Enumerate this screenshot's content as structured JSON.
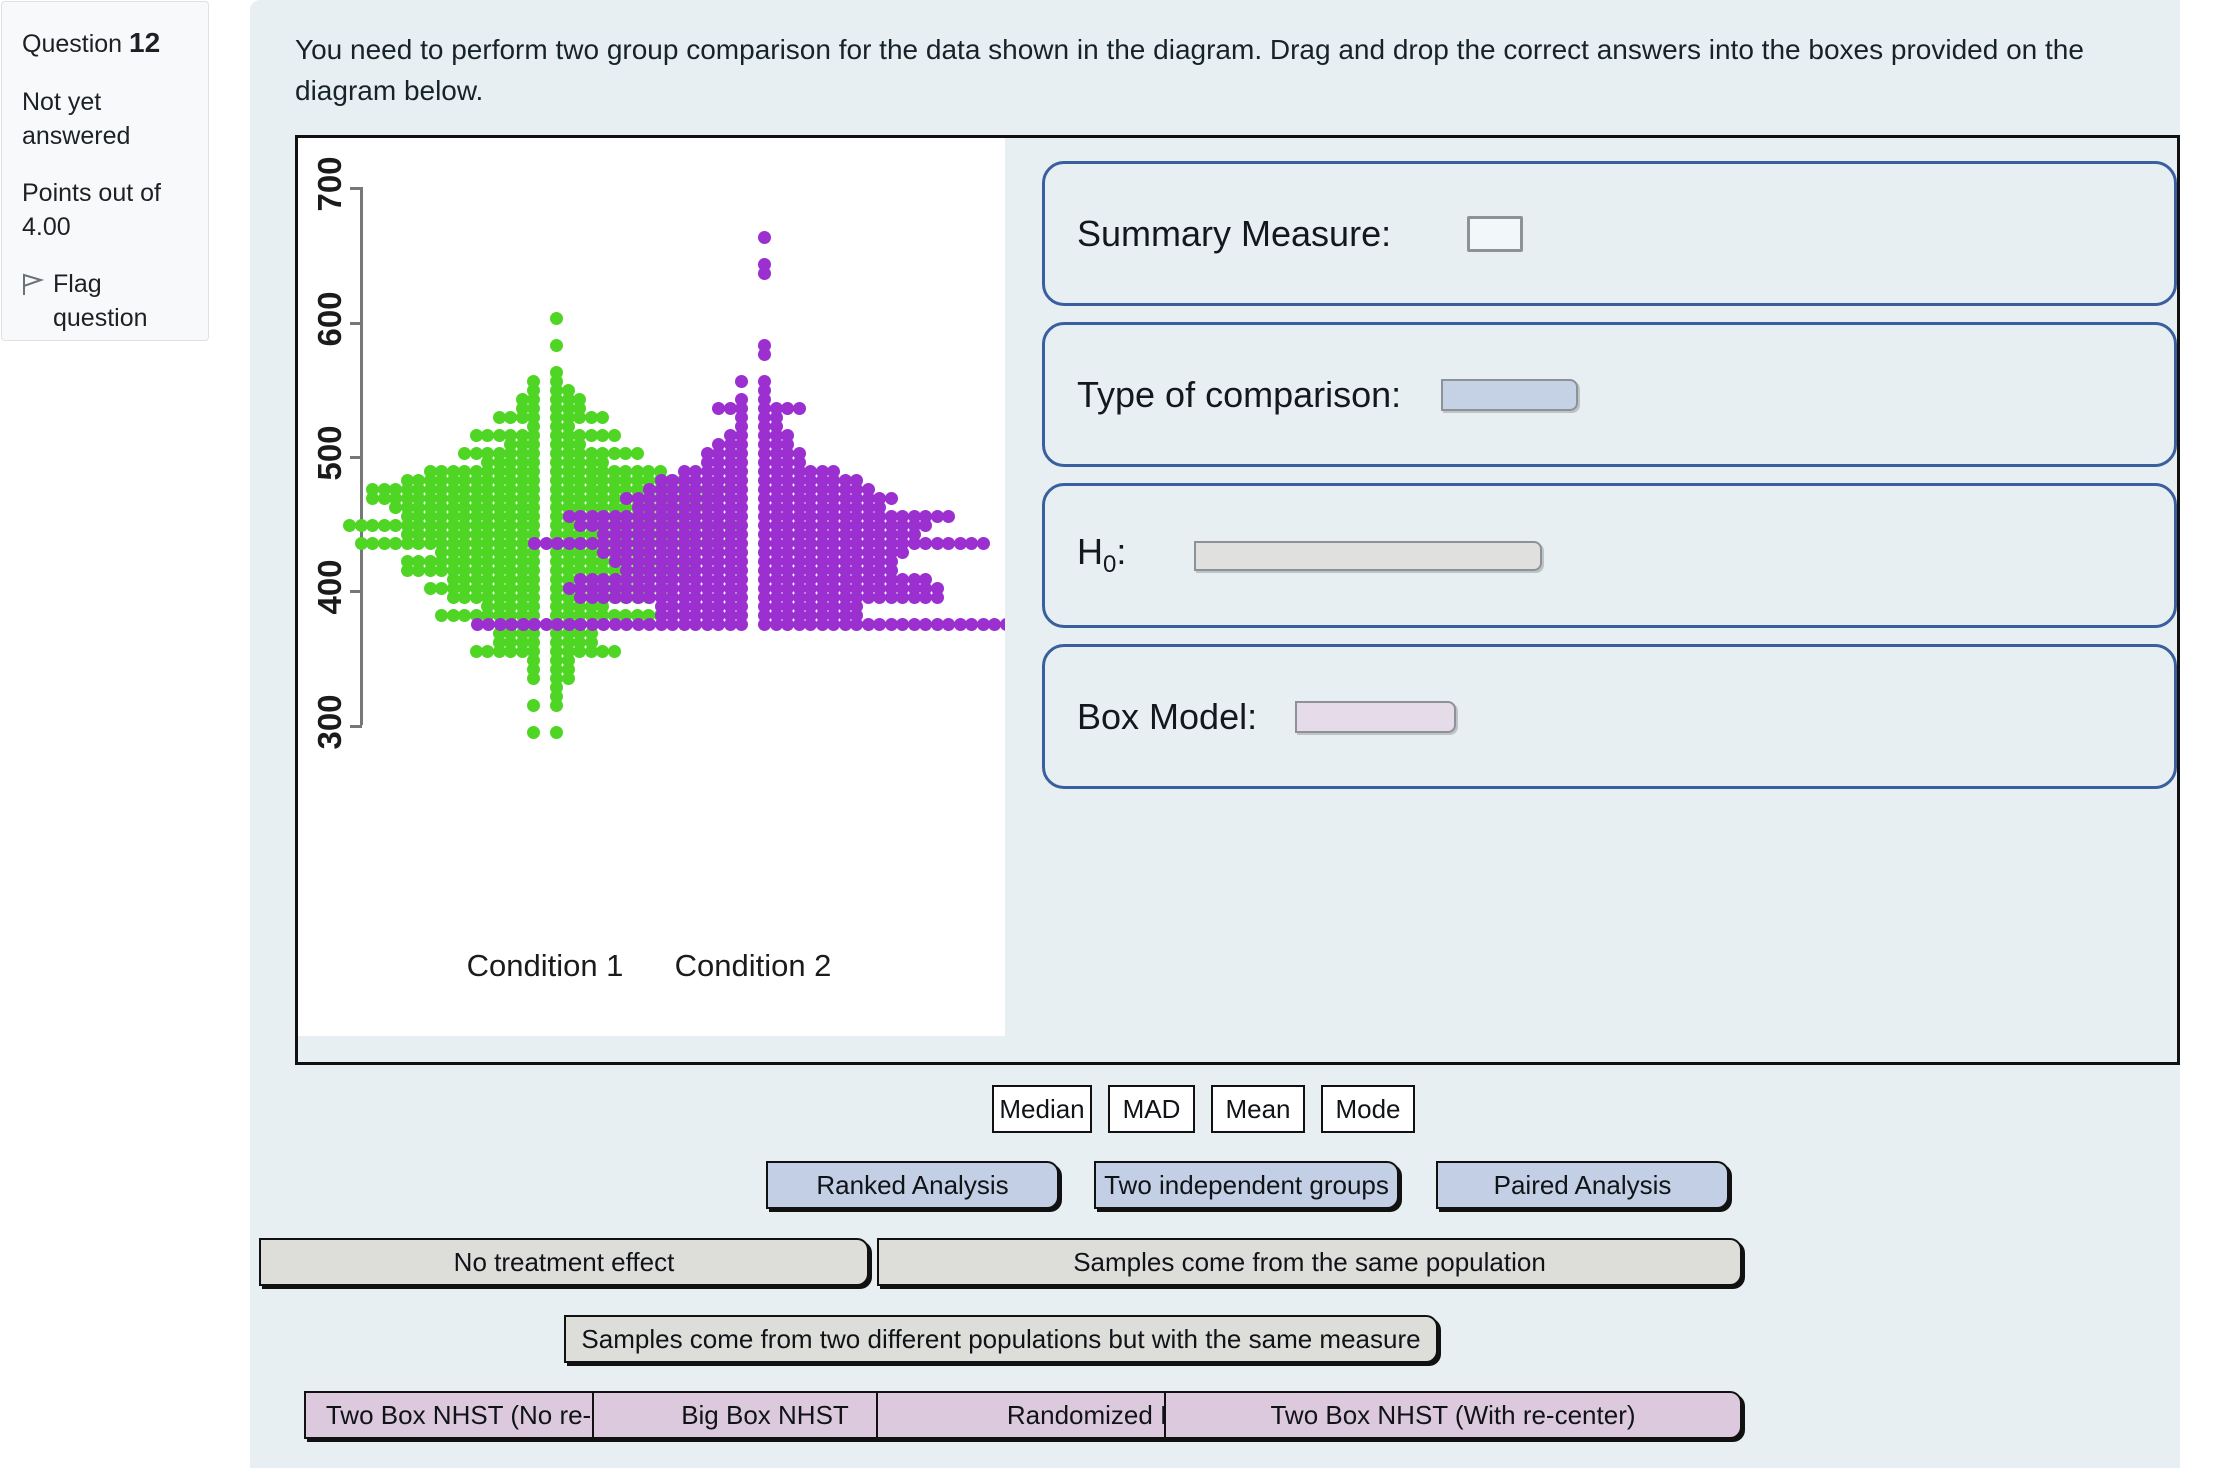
{
  "question_info": {
    "question_word": "Question",
    "question_number": "12",
    "status": "Not yet answered",
    "points": "Points out of 4.00",
    "flag_label": "Flag question",
    "flag_icon": "flag-icon"
  },
  "prompt": "You need to perform two group comparison for the data shown in the diagram. Drag and drop the correct answers into the boxes provided on the diagram below.",
  "chart_data": {
    "type": "scatter",
    "variant": "beeswarm",
    "title": "",
    "xlabel": "",
    "ylabel": "",
    "categories": [
      "Condition 1",
      "Condition 2"
    ],
    "ylim": [
      290,
      710
    ],
    "yticks": [
      300,
      400,
      500,
      600,
      700
    ],
    "ytick_labels": [
      "300",
      "400",
      "500",
      "600",
      "700"
    ],
    "grid": false,
    "legend": "none",
    "series": [
      {
        "name": "Condition 1",
        "color": "#4FD524",
        "n": 520,
        "center": 447,
        "spread": 48,
        "min": 295,
        "max": 600,
        "median": 443
      },
      {
        "name": "Condition 2",
        "color": "#9B2FD0",
        "n": 520,
        "center": 432,
        "spread": 44,
        "min": 378,
        "max": 678,
        "median": 425
      }
    ]
  },
  "drop_zones": [
    {
      "label": "Summary Measure:",
      "slot_kind": "sm",
      "value": ""
    },
    {
      "label": "Type of comparison:",
      "slot_kind": "blue",
      "value": ""
    },
    {
      "label": "H",
      "label_sub": "0",
      "label_tail": ":",
      "slot_kind": "gray",
      "value": ""
    },
    {
      "label": "Box Model:",
      "slot_kind": "purple",
      "value": ""
    }
  ],
  "options": {
    "summary_measure": [
      "Median",
      "MAD",
      "Mean",
      "Mode"
    ],
    "type_of_comparison": [
      "Ranked Analysis",
      "Two independent groups",
      "Paired Analysis"
    ],
    "null_hypothesis": [
      "No treatment effect",
      "Samples come from the same population",
      "Samples come from two different populations but with the same measure"
    ],
    "box_model": [
      "Two Box NHST (No re-center)",
      "Big Box NHST",
      "Randomized Differences",
      "Two Box NHST (With re-center)"
    ]
  },
  "colors": {
    "panel_bg": "#e8eff2",
    "card_border": "#3a5f9e",
    "chip_blue": "#c2cfe4",
    "chip_gray": "#ddddda",
    "chip_purple": "#ddc9de",
    "series1": "#4FD524",
    "series2": "#9B2FD0"
  }
}
